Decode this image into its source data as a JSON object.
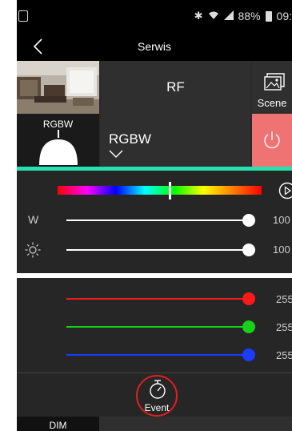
{
  "status_bar": {
    "battery": "88%",
    "time": "09:"
  },
  "header": {
    "title": "Serwis",
    "back_icon": "chevron-left-icon"
  },
  "device": {
    "name": "RF",
    "scene_label": "Scene",
    "scene_icon": "scene-icon"
  },
  "mode": {
    "lamp_label": "RGBW",
    "mode_label": "RGBW",
    "power_icon": "power-icon",
    "power_color": "#f07373"
  },
  "accent_color": "#27e0b0",
  "color_panel": {
    "spectrum_position": 0.55,
    "white": {
      "label": "W",
      "value": "100"
    },
    "brightness": {
      "icon": "sun-icon",
      "value": "100"
    }
  },
  "rgb": {
    "red": {
      "value": "255",
      "color": "#ff1a1a"
    },
    "green": {
      "value": "255",
      "color": "#18d018"
    },
    "blue": {
      "value": "255",
      "color": "#1a3cff"
    }
  },
  "event": {
    "label": "Event",
    "icon": "stopwatch-icon"
  },
  "bottom": {
    "dim_label": "DIM"
  }
}
